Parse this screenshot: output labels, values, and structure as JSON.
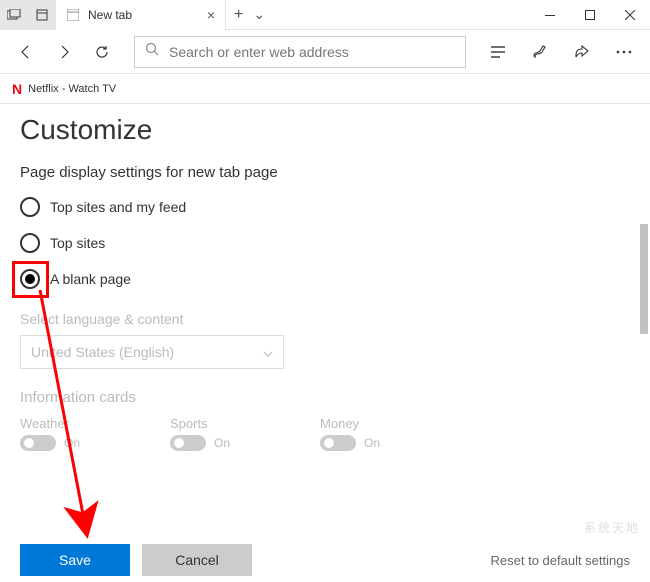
{
  "titlebar": {
    "tab_title": "New tab",
    "plus_label": "+",
    "chevron_label": "⌄"
  },
  "toolbar": {
    "search_placeholder": "Search or enter web address"
  },
  "favorites": {
    "icon_text": "N",
    "item_label": "Netflix - Watch TV"
  },
  "page": {
    "heading": "Customize",
    "subheading": "Page display settings for new tab page",
    "radios": {
      "opt1": "Top sites and my feed",
      "opt2": "Top sites",
      "opt3": "A blank page"
    },
    "lang_label": "Select language & content",
    "lang_value": "United States (English)",
    "cards_heading": "Information cards",
    "cards": {
      "weather": "Weather",
      "sports": "Sports",
      "money": "Money",
      "on": "On"
    },
    "save": "Save",
    "cancel": "Cancel",
    "reset": "Reset to default settings"
  },
  "watermark": "系统天地"
}
